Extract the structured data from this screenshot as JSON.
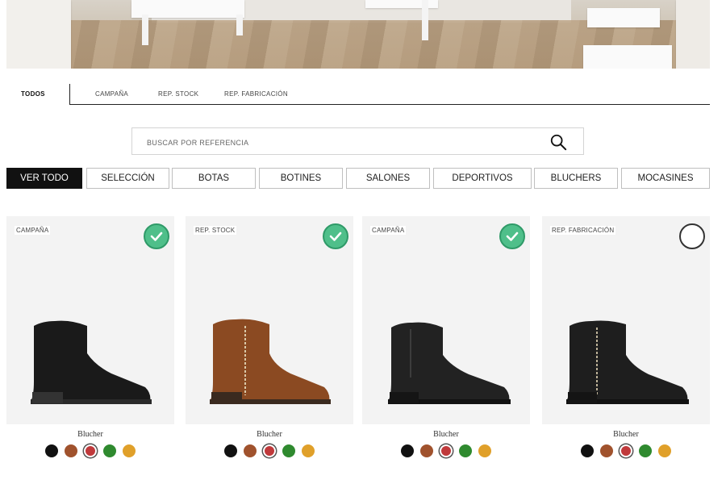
{
  "tabs": [
    "TODOS",
    "CAMPAÑA",
    "REP. STOCK",
    "REP. FABRICACIÓN"
  ],
  "search": {
    "placeholder": "BUSCAR POR REFERENCIA"
  },
  "filters": [
    "VER TODO",
    "SELECCIÓN",
    "BOTAS",
    "BOTINES",
    "SALONES",
    "DEPORTIVOS",
    "BLUCHERS",
    "MOCASINES"
  ],
  "colors": {
    "accent_black": "#111111",
    "check_green": "#4fbf8a",
    "swatches": [
      "#111111",
      "#a0522d",
      "#c0393b",
      "#2f8a2f",
      "#e0a02a"
    ]
  },
  "products": [
    {
      "tag": "CAMPAÑA",
      "name": "Blucher",
      "selected": true,
      "boot_color": "#1a1a1a"
    },
    {
      "tag": "REP. STOCK",
      "name": "Blucher",
      "selected": true,
      "boot_color": "#8b4a22"
    },
    {
      "tag": "CAMPAÑA",
      "name": "Blucher",
      "selected": true,
      "boot_color": "#222222"
    },
    {
      "tag": "REP. FABRICACIÓN",
      "name": "Blucher",
      "selected": false,
      "boot_color": "#1e1e1e"
    }
  ]
}
